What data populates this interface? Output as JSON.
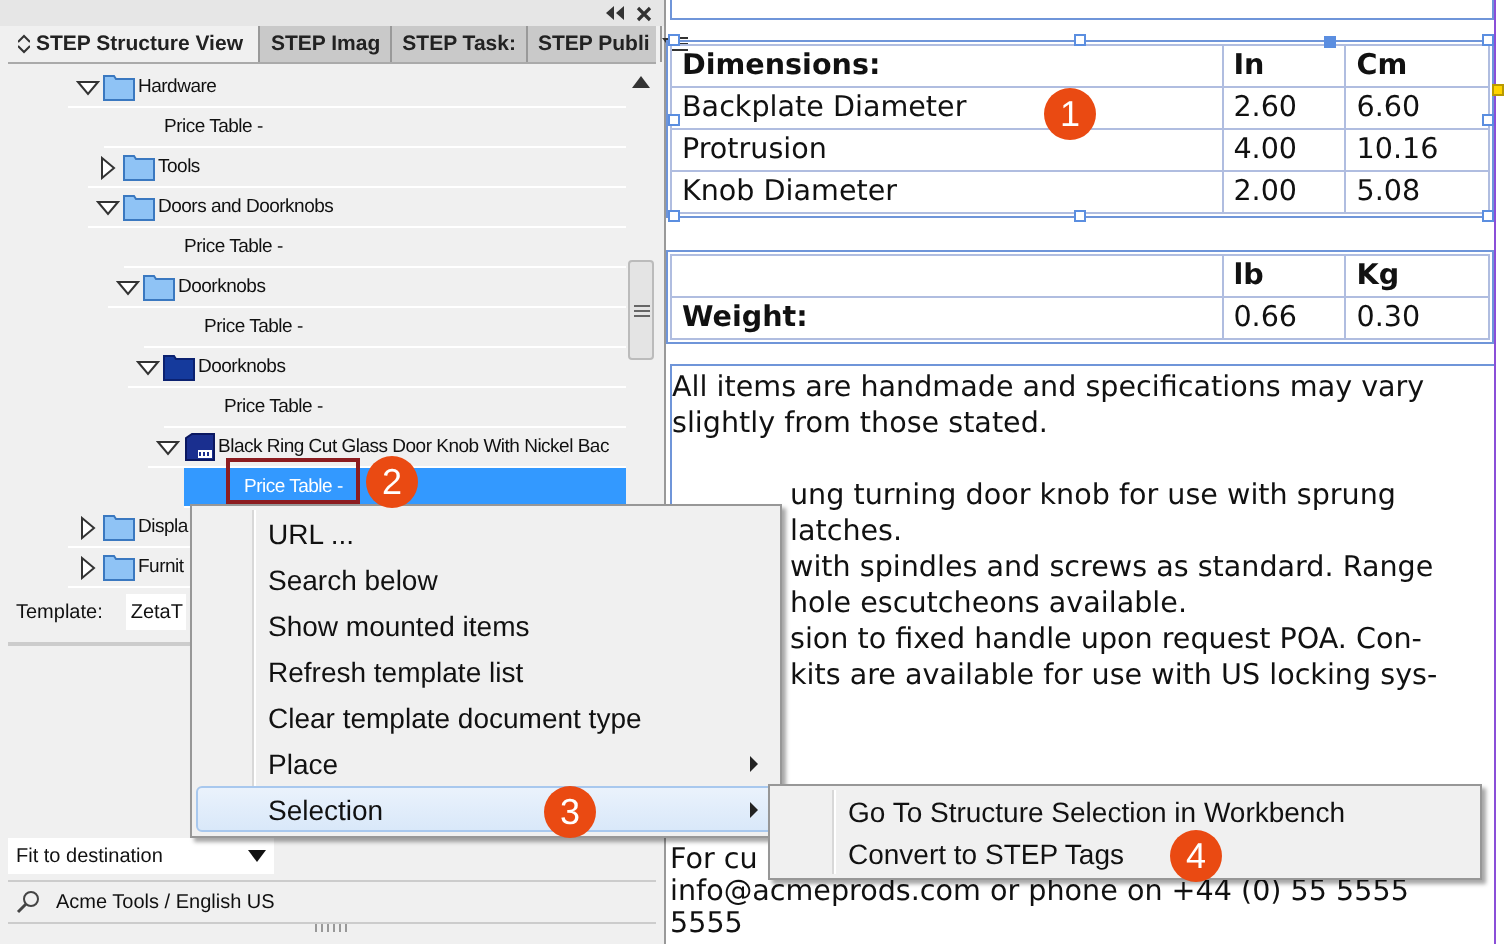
{
  "panel": {
    "tabs": [
      {
        "label": "STEP Structure View",
        "selected": true
      },
      {
        "label": "STEP Imag",
        "selected": false
      },
      {
        "label": "STEP Task:",
        "selected": false
      },
      {
        "label": "STEP Publi",
        "selected": false
      }
    ],
    "tree": [
      {
        "label": "Hardware",
        "kind": "folder",
        "expanded": true,
        "selected": false,
        "children": [
          {
            "label": "Price Table -",
            "kind": "table",
            "selected": false
          },
          {
            "label": "Tools",
            "kind": "folder",
            "expanded": false,
            "selected": false
          },
          {
            "label": "Doors and Doorknobs",
            "kind": "folder",
            "expanded": true,
            "selected": false,
            "children": [
              {
                "label": "Price Table -",
                "kind": "table",
                "selected": false
              },
              {
                "label": "Doorknobs",
                "kind": "folder",
                "expanded": true,
                "selected": false,
                "children": [
                  {
                    "label": "Price Table -",
                    "kind": "table",
                    "selected": false
                  },
                  {
                    "label": "Doorknobs",
                    "kind": "dark-folder",
                    "expanded": true,
                    "selected": false,
                    "children": [
                      {
                        "label": "Price Table -",
                        "kind": "table",
                        "selected": false
                      },
                      {
                        "label": "Black Ring Cut Glass Door Knob With Nickel Bac",
                        "kind": "product",
                        "expanded": true,
                        "selected": false,
                        "children": [
                          {
                            "label": "Price Table -",
                            "kind": "table",
                            "selected": true
                          }
                        ]
                      }
                    ]
                  }
                ]
              }
            ]
          }
        ]
      },
      {
        "label": "Displa",
        "kind": "folder",
        "expanded": false,
        "selected": false
      },
      {
        "label": "Furnit",
        "kind": "folder",
        "expanded": false,
        "selected": false
      }
    ],
    "template_label": "Template:",
    "template_value": "ZetaT",
    "fit_dropdown": "Fit to destination",
    "status": "Acme Tools / English US"
  },
  "context_menu": [
    {
      "label": "URL ...",
      "submenu": false,
      "selected": false
    },
    {
      "label": "Search below",
      "submenu": false,
      "selected": false
    },
    {
      "label": "Show mounted items",
      "submenu": false,
      "selected": false
    },
    {
      "label": "Refresh template list",
      "submenu": false,
      "selected": false
    },
    {
      "label": "Clear template document type",
      "submenu": false,
      "selected": false
    },
    {
      "label": "Place",
      "submenu": true,
      "selected": false
    },
    {
      "label": "Selection",
      "submenu": true,
      "selected": true
    }
  ],
  "submenu": [
    {
      "label": "Go To Structure Selection in Workbench",
      "selected": false
    },
    {
      "label": "Convert to STEP Tags",
      "selected": false
    }
  ],
  "document": {
    "dimensions_table": {
      "columns": [
        "Dimensions:",
        "In",
        "Cm"
      ],
      "rows": [
        [
          "Backplate Diameter",
          "2.60",
          "6.60"
        ],
        [
          "Protrusion",
          "4.00",
          "10.16"
        ],
        [
          "Knob Diameter",
          "2.00",
          "5.08"
        ]
      ]
    },
    "weight_table": {
      "columns": [
        "lb",
        "Kg"
      ],
      "label": "Weight:",
      "values": [
        "0.66",
        "0.30"
      ]
    },
    "lines": [
      {
        "text": "All items are handmade and specifications may vary",
        "kind": "full"
      },
      {
        "text": "slightly from those stated.",
        "kind": "full"
      },
      {
        "kind": "blank"
      },
      {
        "text": "ung turning door knob for use with sprung",
        "kind": "fragment"
      },
      {
        "text": "latches.",
        "kind": "fragment"
      },
      {
        "text": "with spindles and screws as standard. Range",
        "kind": "fragment"
      },
      {
        "text": "hole escutcheons available.",
        "kind": "fragment"
      },
      {
        "text": "sion to fixed handle upon request POA. Con-",
        "kind": "fragment"
      },
      {
        "text": "kits are available for use with US locking sys-",
        "kind": "fragment"
      }
    ],
    "footer_lines": [
      "For cu",
      "info@acmeprods.com or phone on +44 (0) 55 5555",
      "5555"
    ]
  },
  "callouts": [
    "1",
    "2",
    "3",
    "4"
  ]
}
